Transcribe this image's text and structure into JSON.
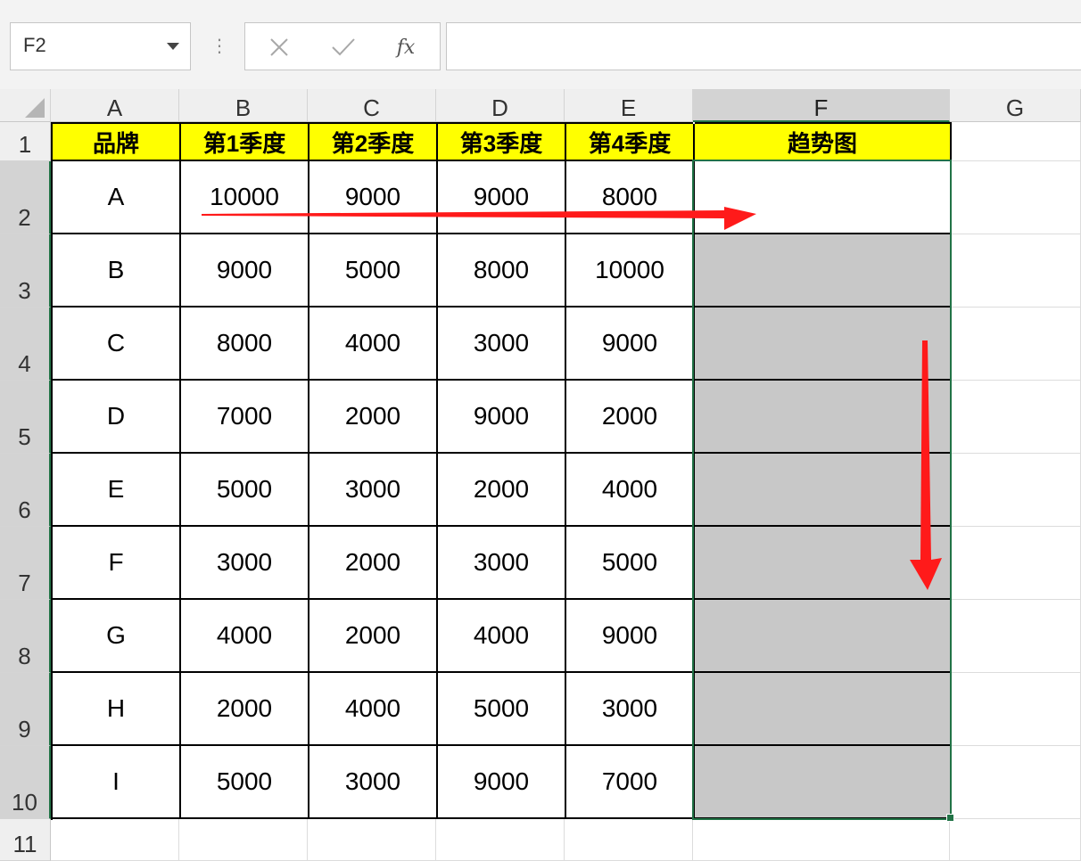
{
  "name_box": {
    "value": "F2"
  },
  "formula_bar": {
    "value": "",
    "cancel_icon": "close-icon",
    "enter_icon": "check-icon",
    "function_label": "fx"
  },
  "columns": [
    "A",
    "B",
    "C",
    "D",
    "E",
    "F",
    "G"
  ],
  "rows": [
    "1",
    "2",
    "3",
    "4",
    "5",
    "6",
    "7",
    "8",
    "9",
    "10",
    "11"
  ],
  "selected_column": "F",
  "active_cell": "F2",
  "table": {
    "headers": [
      "品牌",
      "第1季度",
      "第2季度",
      "第3季度",
      "第4季度",
      "趋势图"
    ],
    "rows": [
      [
        "A",
        "10000",
        "9000",
        "9000",
        "8000"
      ],
      [
        "B",
        "9000",
        "5000",
        "8000",
        "10000"
      ],
      [
        "C",
        "8000",
        "4000",
        "3000",
        "9000"
      ],
      [
        "D",
        "7000",
        "2000",
        "9000",
        "2000"
      ],
      [
        "E",
        "5000",
        "3000",
        "2000",
        "4000"
      ],
      [
        "F",
        "3000",
        "2000",
        "3000",
        "5000"
      ],
      [
        "G",
        "4000",
        "2000",
        "4000",
        "9000"
      ],
      [
        "H",
        "2000",
        "4000",
        "5000",
        "3000"
      ],
      [
        "I",
        "5000",
        "3000",
        "9000",
        "7000"
      ]
    ]
  },
  "colors": {
    "header_fill": "#ffff00",
    "selection": "#217346",
    "selected_fill": "#c8c8c8",
    "arrow": "#ff1a1a"
  }
}
